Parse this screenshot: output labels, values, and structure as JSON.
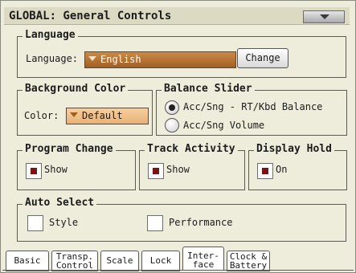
{
  "title": "GLOBAL: General Controls",
  "language": {
    "label": "Language",
    "field_label": "Language:",
    "value": "English",
    "change_button": "Change"
  },
  "background_color": {
    "label": "Background Color",
    "field_label": "Color:",
    "value": "Default"
  },
  "balance_slider": {
    "label": "Balance Slider",
    "options": [
      "Acc/Sng - RT/Kbd Balance",
      "Acc/Sng Volume"
    ],
    "selected_index": 0
  },
  "program_change": {
    "label": "Program Change",
    "check_label": "Show",
    "checked": true
  },
  "track_activity": {
    "label": "Track Activity",
    "check_label": "Show",
    "checked": true
  },
  "display_hold": {
    "label": "Display Hold",
    "check_label": "On",
    "checked": true
  },
  "auto_select": {
    "label": "Auto Select",
    "style_label": "Style",
    "style_checked": false,
    "performance_label": "Performance",
    "performance_checked": false
  },
  "tabs": [
    {
      "line1": "Basic",
      "line2": ""
    },
    {
      "line1": "Transp.",
      "line2": "Control"
    },
    {
      "line1": "Scale",
      "line2": ""
    },
    {
      "line1": "Lock",
      "line2": ""
    },
    {
      "line1": "Inter-",
      "line2": "face"
    },
    {
      "line1": "Clock &",
      "line2": "Battery"
    }
  ],
  "active_tab_index": 4,
  "colors": {
    "panel_bg": "#eeecda",
    "language_dropdown": "#b8702e",
    "color_dropdown": "#f0c08a",
    "check_mark": "#7a1414"
  }
}
